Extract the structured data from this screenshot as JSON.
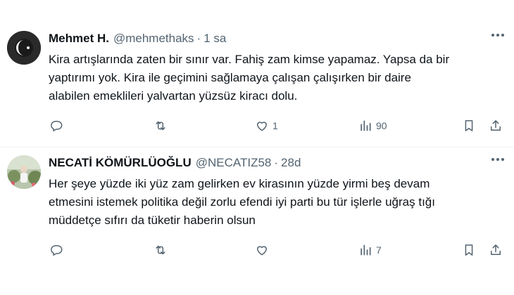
{
  "tweets": [
    {
      "author_name": "Mehmet H.",
      "author_handle": "@mehmethaks",
      "separator": "·",
      "time": "1 sa",
      "text_lines": [
        "Kira artışlarında zaten bir sınır var. Fahiş zam kimse yapamaz. Yapsa da bir",
        "yaptırımı yok. Kira ile geçimini sağlamaya çalışan çalışırken bir daire",
        "alabilen emeklileri yalvartan yüzsüz kiracı dolu."
      ],
      "stats": {
        "replies": "",
        "reposts": "",
        "likes": "1",
        "views": "90"
      },
      "icons": [
        "reply-icon",
        "repost-icon",
        "like-icon",
        "views-icon",
        "bookmark-icon",
        "share-icon",
        "more-icon"
      ]
    },
    {
      "author_name": "NECATİ KÖMÜRLÜOĞLU",
      "author_handle": "@NECATIZ58",
      "separator": "·",
      "time": "28d",
      "text_lines": [
        "Her şeye yüzde iki yüz zam gelirken ev kirasının yüzde yirmi beş devam",
        "etmesini istemek politika değil zorlu efendi iyi parti bu tür işlerle uğraş tığı",
        "müddetçe sıfırı da tüketir haberin olsun"
      ],
      "stats": {
        "replies": "",
        "reposts": "",
        "likes": "",
        "views": "7"
      },
      "icons": [
        "reply-icon",
        "repost-icon",
        "like-icon",
        "views-icon",
        "bookmark-icon",
        "share-icon",
        "more-icon"
      ]
    }
  ],
  "colors": {
    "text": "#0f1419",
    "secondary": "#536471",
    "divider": "#eff3f4",
    "background": "#ffffff"
  }
}
